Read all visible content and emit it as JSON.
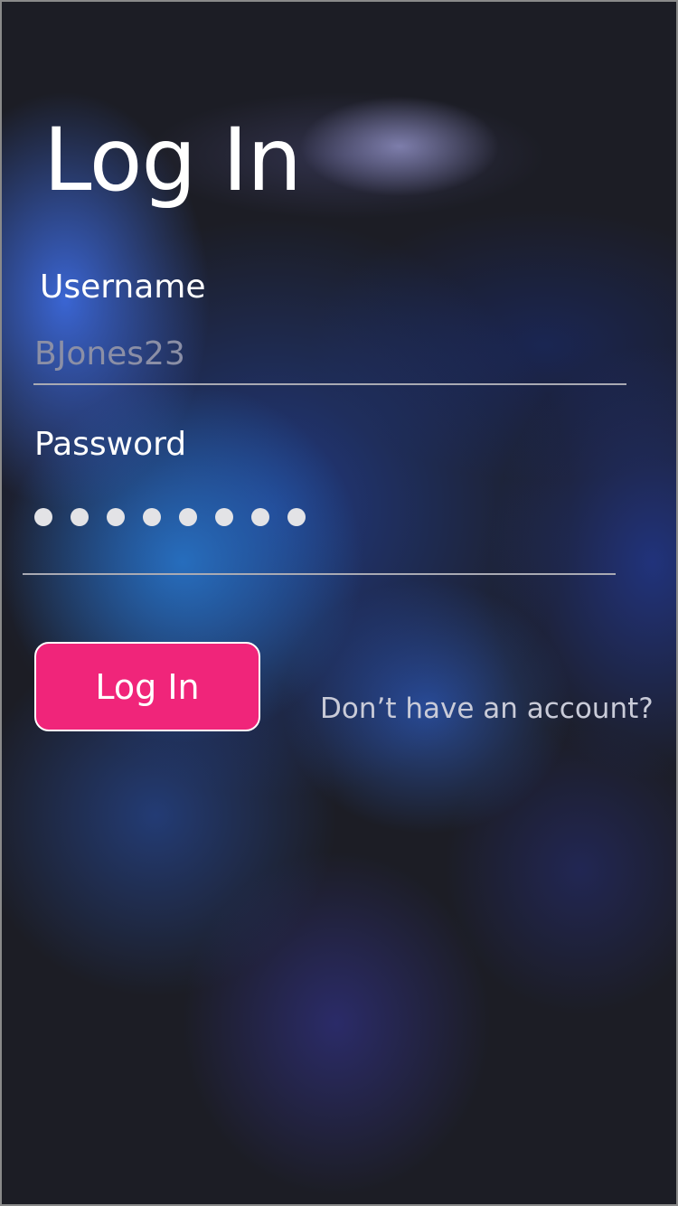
{
  "screen": {
    "title": "Log In"
  },
  "form": {
    "username": {
      "label": "Username",
      "value": "BJones23"
    },
    "password": {
      "label": "Password",
      "masked_length": 8
    },
    "submit_label": "Log In",
    "signup_link": "Don’t have an account?"
  },
  "colors": {
    "accent": "#f0257a",
    "background": "#1c1d25"
  }
}
